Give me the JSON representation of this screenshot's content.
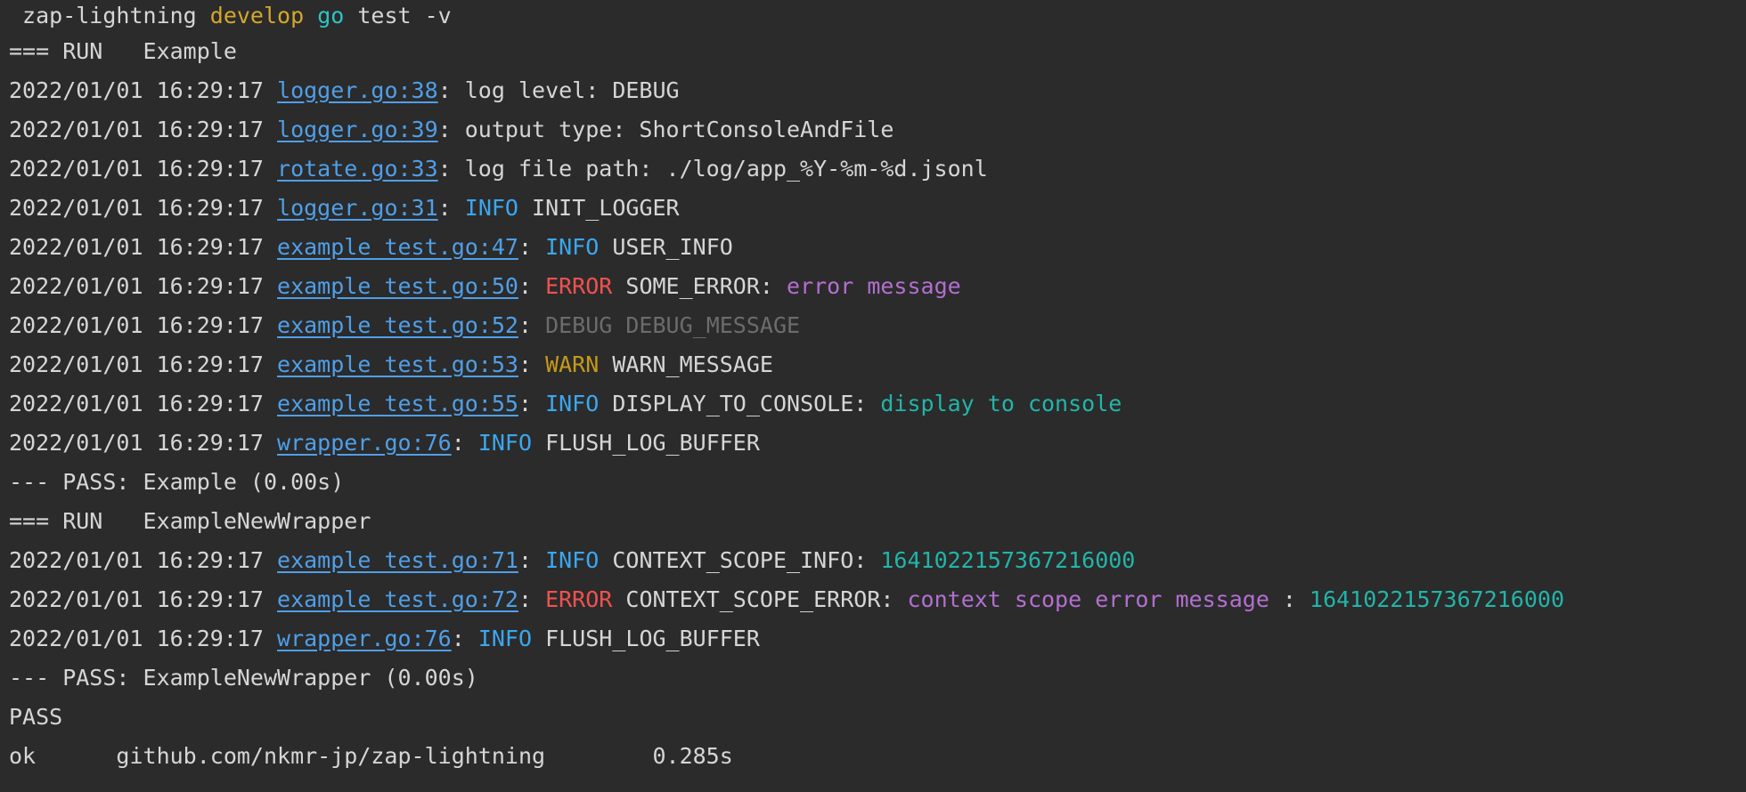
{
  "colors": {
    "background": "#2b2b2b",
    "text": "#d6d6d6",
    "link": "#4f9fe9",
    "info": "#3ba7ef",
    "error": "#f0524f",
    "debug": "#6c6c6c",
    "warn": "#c59a1a",
    "magenta": "#b36fd0",
    "cyan": "#22b5a9",
    "branch": "#d4a72c",
    "go": "#2cc4c4"
  },
  "lines": [
    {
      "name": "prompt-line",
      "segs": [
        {
          "t": " zap-lightning ",
          "c": "plain"
        },
        {
          "t": "develop",
          "c": "branch"
        },
        {
          "t": " ",
          "c": "plain"
        },
        {
          "t": "go",
          "c": "gocmd"
        },
        {
          "t": " test -v",
          "c": "plain"
        }
      ]
    },
    {
      "name": "run-line",
      "segs": [
        {
          "t": "=== RUN   Example",
          "c": "plain"
        }
      ]
    },
    {
      "name": "log-line",
      "segs": [
        {
          "t": "2022/01/01 16:29:17 ",
          "c": "plain"
        },
        {
          "t": "logger.go:38",
          "c": "link"
        },
        {
          "t": ": log level: DEBUG",
          "c": "plain"
        }
      ]
    },
    {
      "name": "log-line",
      "segs": [
        {
          "t": "2022/01/01 16:29:17 ",
          "c": "plain"
        },
        {
          "t": "logger.go:39",
          "c": "link"
        },
        {
          "t": ": output type: ShortConsoleAndFile",
          "c": "plain"
        }
      ]
    },
    {
      "name": "log-line",
      "segs": [
        {
          "t": "2022/01/01 16:29:17 ",
          "c": "plain"
        },
        {
          "t": "rotate.go:33",
          "c": "link"
        },
        {
          "t": ": log file path: ./log/app_%Y-%m-%d.jsonl",
          "c": "plain"
        }
      ]
    },
    {
      "name": "log-line",
      "segs": [
        {
          "t": "2022/01/01 16:29:17 ",
          "c": "plain"
        },
        {
          "t": "logger.go:31",
          "c": "link"
        },
        {
          "t": ": ",
          "c": "plain"
        },
        {
          "t": "INFO",
          "c": "info"
        },
        {
          "t": " INIT_LOGGER",
          "c": "plain"
        }
      ]
    },
    {
      "name": "log-line",
      "segs": [
        {
          "t": "2022/01/01 16:29:17 ",
          "c": "plain"
        },
        {
          "t": "example_test.go:47",
          "c": "link"
        },
        {
          "t": ": ",
          "c": "plain"
        },
        {
          "t": "INFO",
          "c": "info"
        },
        {
          "t": " USER_INFO",
          "c": "plain"
        }
      ]
    },
    {
      "name": "log-line",
      "segs": [
        {
          "t": "2022/01/01 16:29:17 ",
          "c": "plain"
        },
        {
          "t": "example_test.go:50",
          "c": "link"
        },
        {
          "t": ": ",
          "c": "plain"
        },
        {
          "t": "ERROR",
          "c": "error"
        },
        {
          "t": " SOME_ERROR: ",
          "c": "plain"
        },
        {
          "t": "error message",
          "c": "magenta"
        }
      ]
    },
    {
      "name": "log-line",
      "segs": [
        {
          "t": "2022/01/01 16:29:17 ",
          "c": "plain"
        },
        {
          "t": "example_test.go:52",
          "c": "link"
        },
        {
          "t": ": ",
          "c": "plain"
        },
        {
          "t": "DEBUG DEBUG_MESSAGE",
          "c": "debug"
        }
      ]
    },
    {
      "name": "log-line",
      "segs": [
        {
          "t": "2022/01/01 16:29:17 ",
          "c": "plain"
        },
        {
          "t": "example_test.go:53",
          "c": "link"
        },
        {
          "t": ": ",
          "c": "plain"
        },
        {
          "t": "WARN",
          "c": "warn"
        },
        {
          "t": " WARN_MESSAGE",
          "c": "plain"
        }
      ]
    },
    {
      "name": "log-line",
      "segs": [
        {
          "t": "2022/01/01 16:29:17 ",
          "c": "plain"
        },
        {
          "t": "example_test.go:55",
          "c": "link"
        },
        {
          "t": ": ",
          "c": "plain"
        },
        {
          "t": "INFO",
          "c": "info"
        },
        {
          "t": " DISPLAY_TO_CONSOLE: ",
          "c": "plain"
        },
        {
          "t": "display to console",
          "c": "cyan"
        }
      ]
    },
    {
      "name": "log-line",
      "segs": [
        {
          "t": "2022/01/01 16:29:17 ",
          "c": "plain"
        },
        {
          "t": "wrapper.go:76",
          "c": "link"
        },
        {
          "t": ": ",
          "c": "plain"
        },
        {
          "t": "INFO",
          "c": "info"
        },
        {
          "t": " FLUSH_LOG_BUFFER",
          "c": "plain"
        }
      ]
    },
    {
      "name": "pass-line",
      "segs": [
        {
          "t": "--- PASS: Example (0.00s)",
          "c": "plain"
        }
      ]
    },
    {
      "name": "run-line",
      "segs": [
        {
          "t": "=== RUN   ExampleNewWrapper",
          "c": "plain"
        }
      ]
    },
    {
      "name": "log-line",
      "segs": [
        {
          "t": "2022/01/01 16:29:17 ",
          "c": "plain"
        },
        {
          "t": "example_test.go:71",
          "c": "link"
        },
        {
          "t": ": ",
          "c": "plain"
        },
        {
          "t": "INFO",
          "c": "info"
        },
        {
          "t": " CONTEXT_SCOPE_INFO: ",
          "c": "plain"
        },
        {
          "t": "1641022157367216000",
          "c": "cyan"
        }
      ]
    },
    {
      "name": "log-line",
      "segs": [
        {
          "t": "2022/01/01 16:29:17 ",
          "c": "plain"
        },
        {
          "t": "example_test.go:72",
          "c": "link"
        },
        {
          "t": ": ",
          "c": "plain"
        },
        {
          "t": "ERROR",
          "c": "error"
        },
        {
          "t": " CONTEXT_SCOPE_ERROR: ",
          "c": "plain"
        },
        {
          "t": "context scope error message",
          "c": "magenta"
        },
        {
          "t": " : ",
          "c": "plain"
        },
        {
          "t": "1641022157367216000",
          "c": "cyan"
        }
      ]
    },
    {
      "name": "log-line",
      "segs": [
        {
          "t": "2022/01/01 16:29:17 ",
          "c": "plain"
        },
        {
          "t": "wrapper.go:76",
          "c": "link"
        },
        {
          "t": ": ",
          "c": "plain"
        },
        {
          "t": "INFO",
          "c": "info"
        },
        {
          "t": " FLUSH_LOG_BUFFER",
          "c": "plain"
        }
      ]
    },
    {
      "name": "pass-line",
      "segs": [
        {
          "t": "--- PASS: ExampleNewWrapper (0.00s)",
          "c": "plain"
        }
      ]
    },
    {
      "name": "pass-summary-line",
      "segs": [
        {
          "t": "PASS",
          "c": "plain"
        }
      ]
    },
    {
      "name": "result-line",
      "segs": [
        {
          "t": "ok      github.com/nkmr-jp/zap-lightning        0.285s",
          "c": "plain"
        }
      ]
    }
  ]
}
